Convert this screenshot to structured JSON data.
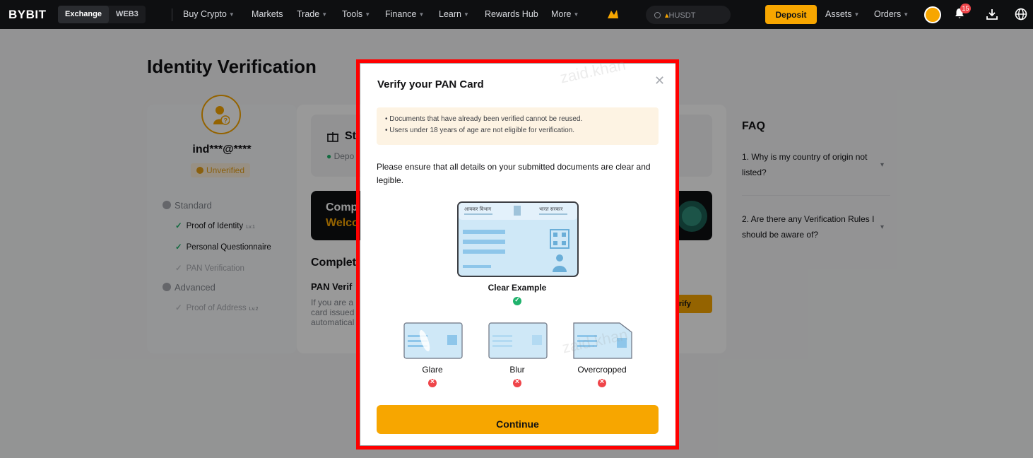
{
  "nav": {
    "logo": "BYBIT",
    "segments": [
      "Exchange",
      "WEB3"
    ],
    "menu": [
      {
        "label": "Buy Crypto",
        "chevron": true
      },
      {
        "label": "Markets",
        "chevron": false
      },
      {
        "label": "Trade",
        "chevron": true
      },
      {
        "label": "Tools",
        "chevron": true
      },
      {
        "label": "Finance",
        "chevron": true
      },
      {
        "label": "Learn",
        "chevron": true
      },
      {
        "label": "Rewards Hub",
        "chevron": false
      },
      {
        "label": "More",
        "chevron": true
      }
    ],
    "search_value": "HUSDT",
    "deposit_label": "Deposit",
    "assets_label": "Assets",
    "orders_label": "Orders",
    "notification_count": "15"
  },
  "page": {
    "title": "Identity Verification",
    "profile": {
      "email": "ind***@****",
      "status": "Unverified"
    },
    "levels": [
      {
        "label": "Standard",
        "items": [
          {
            "label": "Proof of Identity",
            "tag": "Lv.1",
            "done": true
          },
          {
            "label": "Personal Questionnaire",
            "tag": "",
            "done": true
          },
          {
            "label": "PAN Verification",
            "tag": "",
            "done": false
          }
        ]
      },
      {
        "label": "Advanced",
        "items": [
          {
            "label": "Proof of Address",
            "tag": "Lv.2",
            "done": false
          }
        ]
      }
    ],
    "step_box": {
      "title": "St",
      "sub": "Depo"
    },
    "banner": {
      "line1": "Comp",
      "line2": "Welco"
    },
    "complete_heading": "Complete",
    "pan_heading": "PAN Verif",
    "pan_text": [
      "If you are a",
      "card issued",
      "automatical"
    ],
    "verify_label": "rify",
    "faq": {
      "title": "FAQ",
      "questions": [
        "1. Why is my country of origin not listed?",
        "2. Are there any Verification Rules I should be aware of?"
      ]
    }
  },
  "modal": {
    "title": "Verify your PAN Card",
    "notices": [
      "• Documents that have already been verified cannot be reused.",
      "• Users under 18 years of age are not eligible for verification."
    ],
    "instruction": "Please ensure that all details on your submitted documents are clear and legible.",
    "clear_example": "Clear Example",
    "bad_examples": [
      "Glare",
      "Blur",
      "Overcropped"
    ],
    "continue_label": "Continue",
    "card_header_left": "आयकर विभाग",
    "card_header_right": "भारत सरकार"
  },
  "colors": {
    "brand": "#f7a600",
    "success": "#20b26c",
    "error": "#ef454a",
    "highlight": "#ff0000"
  },
  "watermark": "zaid.khan"
}
